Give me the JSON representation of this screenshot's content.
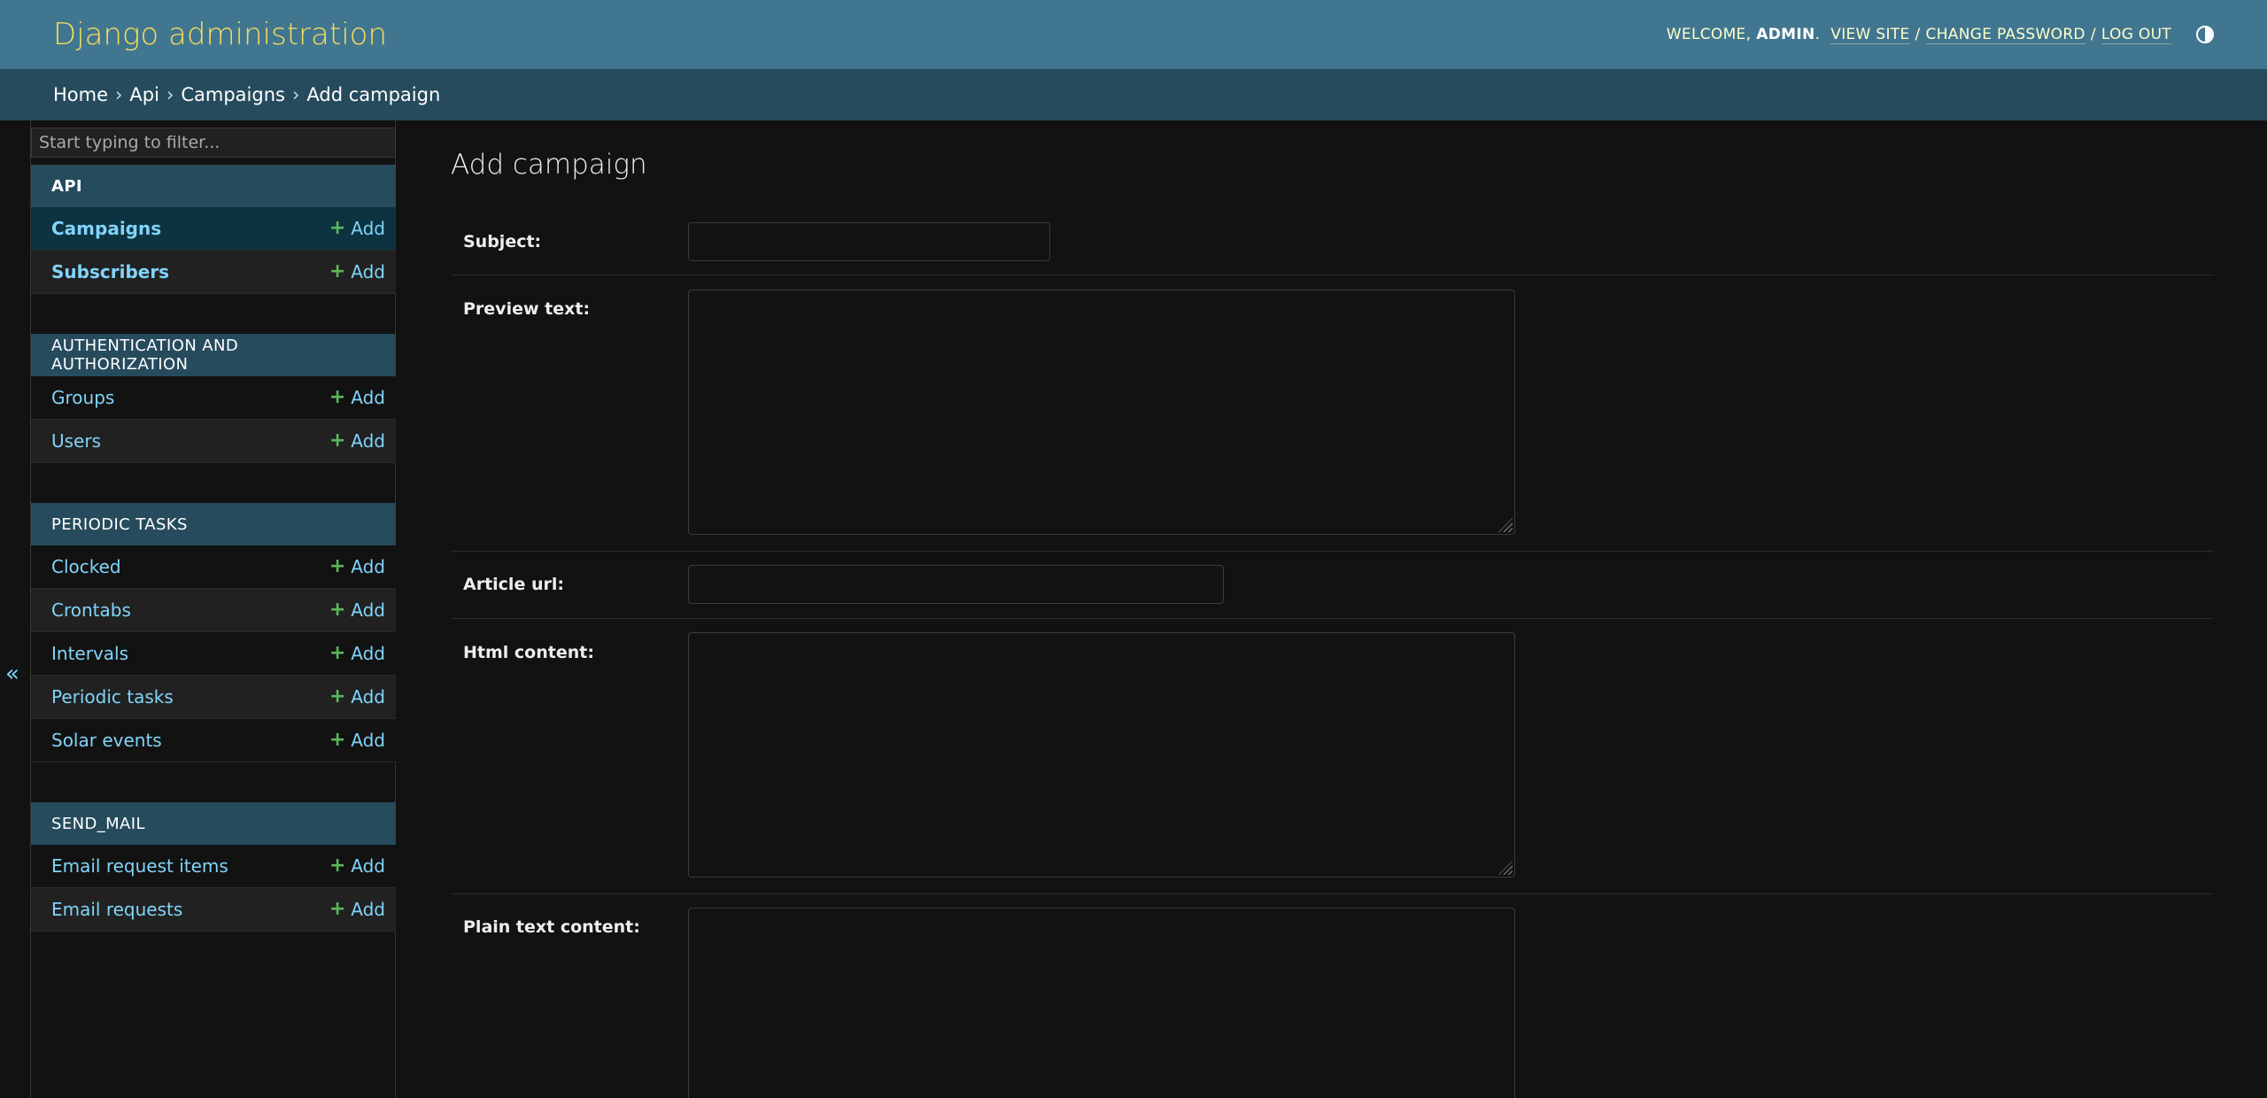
{
  "header": {
    "site_name": "Django administration",
    "welcome": "WELCOME,",
    "username": "ADMIN",
    "view_site": "VIEW SITE",
    "change_password": "CHANGE PASSWORD",
    "log_out": "LOG OUT",
    "theme_icon": "theme-toggle-icon"
  },
  "breadcrumbs": {
    "items": [
      "Home",
      "Api",
      "Campaigns",
      "Add campaign"
    ],
    "separator": "›"
  },
  "sidebar": {
    "filter_placeholder": "Start typing to filter...",
    "collapse_icon": "«",
    "add_label": "Add",
    "modules": [
      {
        "caption": "API",
        "models": [
          "Campaigns",
          "Subscribers"
        ]
      },
      {
        "caption": "AUTHENTICATION AND AUTHORIZATION",
        "models": [
          "Groups",
          "Users"
        ]
      },
      {
        "caption": "PERIODIC TASKS",
        "models": [
          "Clocked",
          "Crontabs",
          "Intervals",
          "Periodic tasks",
          "Solar events"
        ]
      },
      {
        "caption": "SEND_MAIL",
        "models": [
          "Email request items",
          "Email requests"
        ]
      }
    ]
  },
  "content": {
    "title": "Add campaign",
    "fields": {
      "subject": {
        "label": "Subject:",
        "value": ""
      },
      "preview_text": {
        "label": "Preview text:",
        "value": ""
      },
      "article_url": {
        "label": "Article url:",
        "value": ""
      },
      "html_content": {
        "label": "Html content:",
        "value": ""
      },
      "plain_text_content": {
        "label": "Plain text content:",
        "value": ""
      }
    }
  },
  "colors": {
    "header_bg": "#417690",
    "breadcrumbs_bg": "#264b5d",
    "site_name": "#f5dd5d",
    "link": "#81d4fa",
    "add_icon": "#5bb75b",
    "body_bg": "#121212"
  }
}
